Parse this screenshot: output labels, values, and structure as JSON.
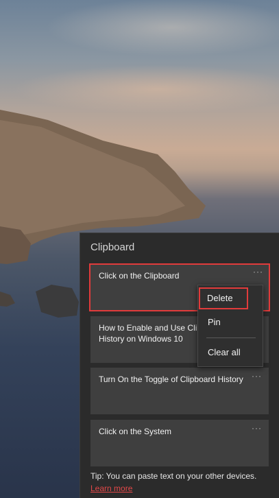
{
  "clipboard": {
    "title": "Clipboard",
    "items": [
      {
        "text": "Click on the Clipboard"
      },
      {
        "text": "How to Enable and Use Clipboard History on Windows 10"
      },
      {
        "text": "Turn On the Toggle of Clipboard History"
      },
      {
        "text": "Click on the System"
      }
    ],
    "more_glyph": "···",
    "menu": {
      "delete": "Delete",
      "pin": "Pin",
      "clear_all": "Clear all"
    },
    "tip": "Tip: You can paste text on your other devices.",
    "learn_more": "Learn more"
  },
  "colors": {
    "panel_bg": "#2b2b2b",
    "card_bg": "#3f3f3f",
    "highlight_red": "#e23b3b",
    "link_red": "#e34848"
  },
  "icons": [
    "more-options-icon"
  ]
}
